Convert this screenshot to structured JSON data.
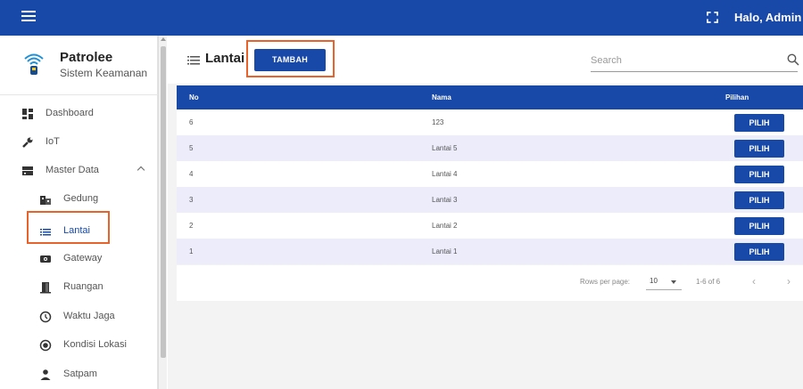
{
  "topbar": {
    "menu_icon": "hamburger-icon",
    "fullscreen_icon": "fullscreen-icon",
    "greeting": "Halo, Admin",
    "color": "#1849a8"
  },
  "brand": {
    "logo_icon": "wifi-beacon-icon",
    "title": "Patrolee",
    "subtitle": "Sistem Keamanan"
  },
  "sidebar": {
    "items": [
      {
        "label": "Dashboard",
        "icon": "dashboard-icon"
      },
      {
        "label": "IoT",
        "icon": "wrench-icon"
      },
      {
        "label": "Master Data",
        "icon": "database-icon",
        "expanded": true
      }
    ],
    "sub_items": [
      {
        "label": "Gedung",
        "icon": "building-icon"
      },
      {
        "label": "Lantai",
        "icon": "list-icon",
        "active": true
      },
      {
        "label": "Gateway",
        "icon": "router-icon"
      },
      {
        "label": "Ruangan",
        "icon": "door-icon"
      },
      {
        "label": "Waktu Jaga",
        "icon": "clock-icon"
      },
      {
        "label": "Kondisi Lokasi",
        "icon": "radio-icon"
      },
      {
        "label": "Satpam",
        "icon": "person-icon"
      }
    ]
  },
  "page": {
    "title": "Lantai",
    "add_label": "TAMBAH",
    "search_placeholder": "Search"
  },
  "table": {
    "headers": [
      "No",
      "Nama",
      "Pilihan"
    ],
    "rows": [
      {
        "no": "6",
        "nama": "123",
        "action": "PILIH"
      },
      {
        "no": "5",
        "nama": "Lantai 5",
        "action": "PILIH"
      },
      {
        "no": "4",
        "nama": "Lantai 4",
        "action": "PILIH"
      },
      {
        "no": "3",
        "nama": "Lantai 3",
        "action": "PILIH"
      },
      {
        "no": "2",
        "nama": "Lantai 2",
        "action": "PILIH"
      },
      {
        "no": "1",
        "nama": "Lantai 1",
        "action": "PILIH"
      }
    ]
  },
  "pagination": {
    "rows_per_page_label": "Rows per page:",
    "rows_per_page_value": "10",
    "range": "1-6 of 6",
    "prev": "‹",
    "next": "›"
  }
}
